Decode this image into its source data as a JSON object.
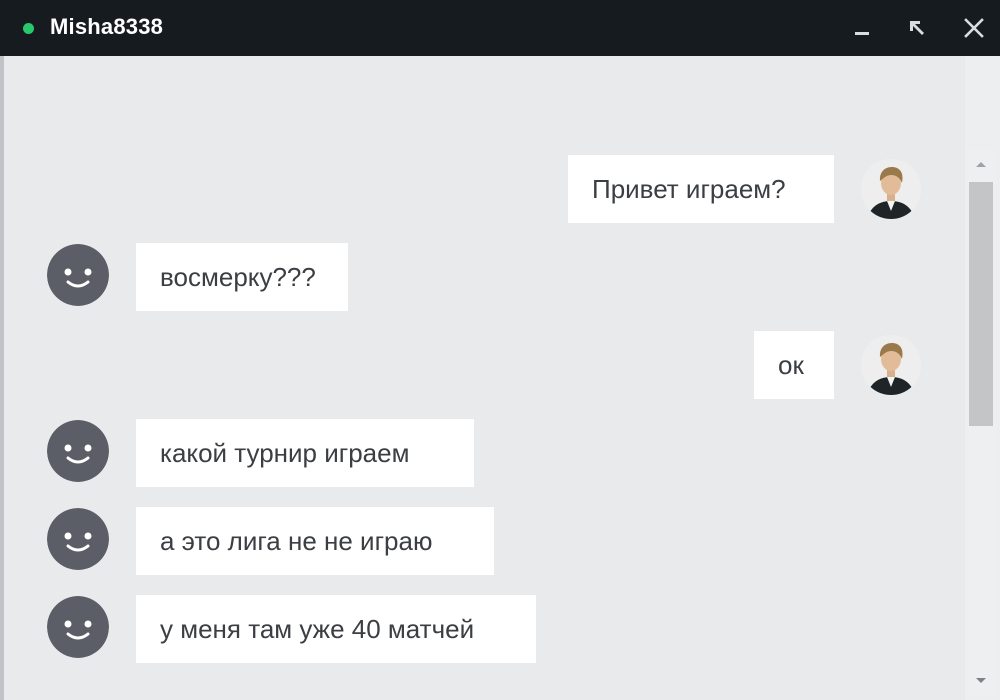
{
  "window": {
    "title": "Misha8338",
    "status_color": "#28c96a",
    "controls": [
      "minimize-icon",
      "popout-icon",
      "close-icon"
    ]
  },
  "messages": [
    {
      "side": "outgoing",
      "text": "Привет играем?"
    },
    {
      "side": "incoming",
      "text": "восмерку???"
    },
    {
      "side": "outgoing",
      "text": "ок"
    },
    {
      "side": "incoming",
      "text": "какой турнир играем"
    },
    {
      "side": "incoming",
      "text": "а это лига не не играю"
    },
    {
      "side": "incoming",
      "text": "у меня там уже 40 матчей"
    }
  ],
  "colors": {
    "titlebar": "#161b20",
    "chat_background": "#e8eaec",
    "bubble": "#ffffff",
    "text": "#3b3e42",
    "default_avatar": "#5b5e67"
  }
}
